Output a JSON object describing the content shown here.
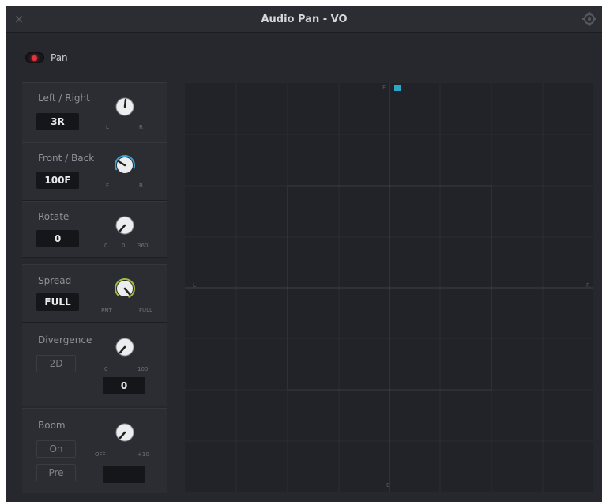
{
  "window": {
    "title": "Audio Pan - VO",
    "close_glyph": "×",
    "menu_icon": "gear-icon"
  },
  "pan_toggle": {
    "label": "Pan",
    "on": true,
    "indicator_color": "#e5333c"
  },
  "controls": {
    "left_right": {
      "label": "Left / Right",
      "value": "3R",
      "tick_min": "L",
      "tick_max": "R"
    },
    "front_back": {
      "label": "Front / Back",
      "value": "100F",
      "tick_min": "F",
      "tick_max": "B"
    },
    "rotate": {
      "label": "Rotate",
      "value": "0",
      "tick_min": "0",
      "tick_mid": "0",
      "tick_max": "360"
    },
    "spread": {
      "label": "Spread",
      "value": "FULL",
      "tick_min": "PNT",
      "tick_max": "FULL"
    },
    "divergence": {
      "label": "Divergence",
      "mode": "2D",
      "value": "0",
      "tick_min": "0",
      "tick_max": "100"
    },
    "boom": {
      "label": "Boom",
      "on_button": "On",
      "pre_button": "Pre",
      "value": "",
      "tick_min": "OFF",
      "tick_max": "+10"
    }
  },
  "pan_area": {
    "label_top": "F",
    "label_bottom": "B",
    "label_left": "L",
    "label_right": "R",
    "point_color": "#2aa6c8"
  },
  "colors": {
    "background": "#26282e",
    "panel": "#2b2d33",
    "value_box": "#15161a",
    "accent_blue": "#3f9fd0",
    "accent_green": "#9cbf3a"
  }
}
